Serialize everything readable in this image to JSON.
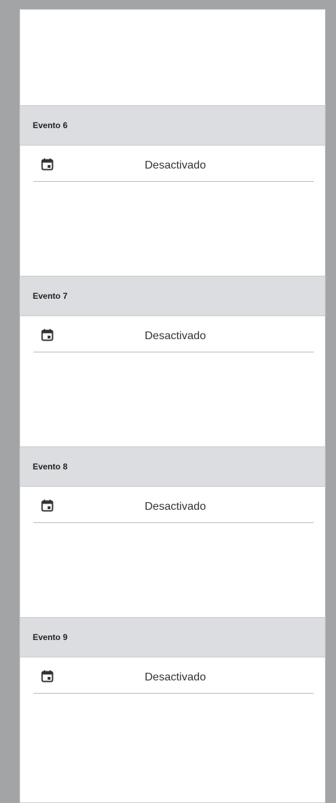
{
  "events": [
    {
      "title": "Evento 6",
      "status": "Desactivado",
      "icon": "calendar-icon"
    },
    {
      "title": "Evento 7",
      "status": "Desactivado",
      "icon": "calendar-icon"
    },
    {
      "title": "Evento 8",
      "status": "Desactivado",
      "icon": "calendar-icon"
    },
    {
      "title": "Evento 9",
      "status": "Desactivado",
      "icon": "calendar-icon"
    }
  ],
  "colors": {
    "background": "#a3a4a6",
    "panel": "#ffffff",
    "header": "#dcdde0"
  }
}
